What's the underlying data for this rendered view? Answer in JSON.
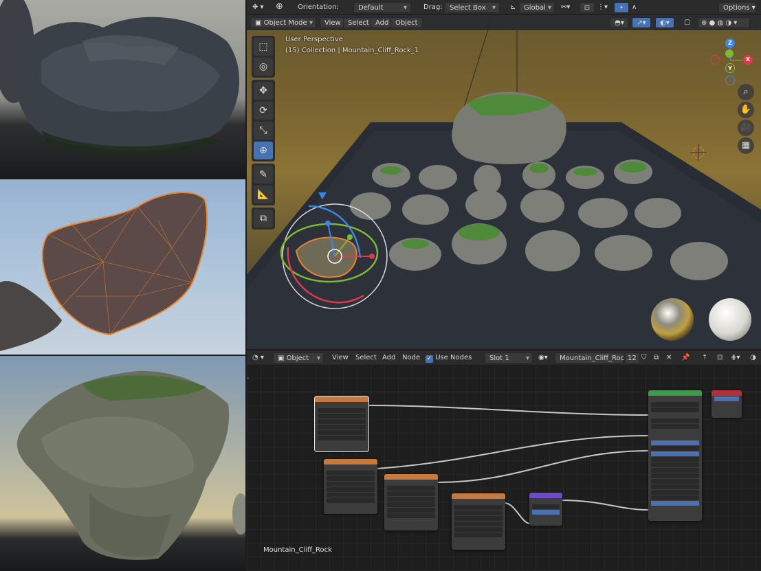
{
  "viewport": {
    "header": {
      "orientation_label": "Orientation:",
      "orientation_value": "Default",
      "drag_label": "Drag:",
      "drag_value": "Select Box",
      "transform_space": "Global",
      "options_label": "Options"
    },
    "menubar": {
      "mode": "Object Mode",
      "menu_view": "View",
      "menu_select": "Select",
      "menu_add": "Add",
      "menu_object": "Object"
    },
    "overlay": {
      "perspective": "User Perspective",
      "collection": "(15) Collection | Mountain_Cliff_Rock_1"
    },
    "gizmo": {
      "x": "X",
      "y": "Y",
      "z": "Z"
    }
  },
  "node_editor": {
    "header": {
      "object_type": "Object",
      "menu_view": "View",
      "menu_select": "Select",
      "menu_add": "Add",
      "menu_node": "Node",
      "use_nodes_label": "Use Nodes",
      "use_nodes_checked": true,
      "slot": "Slot 1",
      "material_name": "Mountain_Cliff_Rock",
      "user_count": "12"
    },
    "material_label": "Mountain_Cliff_Rock"
  },
  "colors": {
    "accent": "#4772b3",
    "texture_node": "#c87a3c",
    "shader_node": "#3e9a4a",
    "output_node": "#b2303d",
    "vector_node": "#6a4cc4",
    "axis_x": "#e0394c",
    "axis_y": "#7fb934",
    "axis_z": "#3c86e8"
  },
  "icons": [
    "editor-type-icon",
    "transform-pivot-icon",
    "global-axes-icon",
    "link-icon",
    "snap-icon",
    "proportional-icon",
    "select-tool-icon",
    "cursor-tool-icon",
    "move-tool-icon",
    "rotate-tool-icon",
    "scale-tool-icon",
    "transform-tool-icon",
    "annotate-tool-icon",
    "measure-tool-icon",
    "add-cube-tool-icon",
    "zoom-icon",
    "pan-hand-icon",
    "camera-icon",
    "grid-icon",
    "pin-icon",
    "shield-icon",
    "duplicate-icon",
    "close-icon"
  ]
}
